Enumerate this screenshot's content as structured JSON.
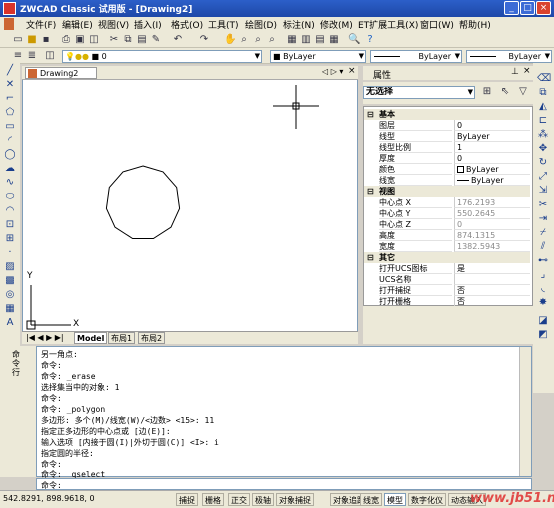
{
  "app": {
    "title": "ZWCAD Classic 试用版 - [Drawing2]"
  },
  "menu": [
    "文件(F)",
    "编辑(E)",
    "视图(V)",
    "插入(I)",
    "格式(O)",
    "工具(T)",
    "绘图(D)",
    "标注(N)",
    "修改(M)",
    "ET扩展工具(X)",
    "窗口(W)",
    "帮助(H)"
  ],
  "layer_toolbar": {
    "layer_value": "0",
    "color_value": "ByLayer",
    "linetype_value": "ByLayer",
    "lineweight_value": "ByLayer"
  },
  "drawing": {
    "tab_title": "Drawing2",
    "axis_x": "X",
    "axis_y": "Y"
  },
  "layout_tabs": [
    "Model",
    "布局1",
    "布局2"
  ],
  "properties": {
    "title": "属性",
    "selection": "无选择",
    "categories": {
      "basic": {
        "label": "基本",
        "rows": [
          {
            "key": "图层",
            "value": "0"
          },
          {
            "key": "线型",
            "value": "ByLayer"
          },
          {
            "key": "线型比例",
            "value": "1"
          },
          {
            "key": "厚度",
            "value": "0"
          },
          {
            "key": "颜色",
            "value": "ByLayer"
          },
          {
            "key": "线宽",
            "value": "ByLayer"
          }
        ]
      },
      "view": {
        "label": "视图",
        "rows": [
          {
            "key": "中心点 X",
            "value": "176.2193"
          },
          {
            "key": "中心点 Y",
            "value": "550.2645"
          },
          {
            "key": "中心点 Z",
            "value": "0"
          },
          {
            "key": "高度",
            "value": "874.1315"
          },
          {
            "key": "宽度",
            "value": "1382.5943"
          }
        ]
      },
      "other": {
        "label": "其它",
        "rows": [
          {
            "key": "打开UCS图标",
            "value": "是"
          },
          {
            "key": "UCS名称",
            "value": ""
          },
          {
            "key": "打开捕捉",
            "value": "否"
          },
          {
            "key": "打开栅格",
            "value": "否"
          }
        ]
      }
    }
  },
  "command": {
    "history": [
      "另一角点:",
      "命令:",
      "命令: _erase",
      "选择集当中的对象: 1",
      "命令:",
      "命令: _polygon",
      "多边形: 多个(M)/线宽(W)/<边数> <15>: 11",
      "指定正多边形的中心点或 [边(E)]:",
      "输入选项 [内接于圆(I)|外切于圆(C)] <I>: i",
      "指定圆的半径:",
      "命令:",
      "命令: _qselect"
    ],
    "prompt": "命令:",
    "side_label": "命令行"
  },
  "status": {
    "coords": "542.8291, 898.9618, 0",
    "buttons": [
      "捕捉",
      "栅格",
      "正交",
      "极轴",
      "对象捕捉",
      "对象追踪",
      "线宽",
      "模型",
      "数字化仪",
      "动态输入"
    ],
    "active": [
      "模型"
    ]
  },
  "watermark": "www.jb51.net"
}
